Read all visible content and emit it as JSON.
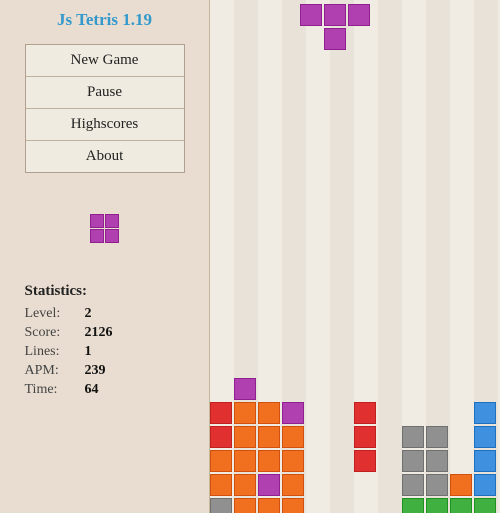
{
  "app": {
    "title": "Js Tetris 1.19"
  },
  "menu": {
    "items": [
      {
        "label": "New Game",
        "name": "new-game"
      },
      {
        "label": "Pause",
        "name": "pause"
      },
      {
        "label": "Highscores",
        "name": "highscores"
      },
      {
        "label": "About",
        "name": "about"
      }
    ]
  },
  "stats": {
    "title": "Statistics:",
    "level_label": "Level:",
    "level_value": "2",
    "score_label": "Score:",
    "score_value": "2126",
    "lines_label": "Lines:",
    "lines_value": "1",
    "apm_label": "APM:",
    "apm_value": "239",
    "time_label": "Time:",
    "time_value": "64"
  }
}
